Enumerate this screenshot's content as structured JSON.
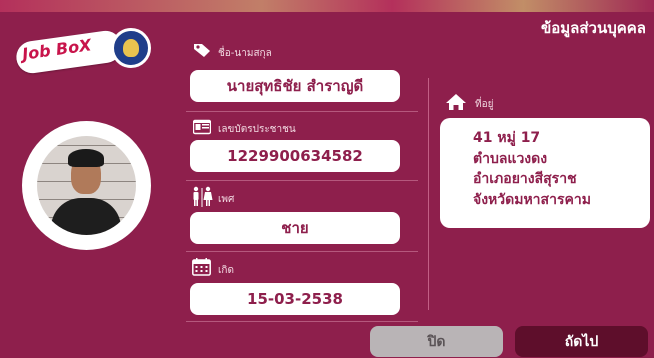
{
  "header": {
    "title": "ข้อมูลส่วนบุคคล"
  },
  "logo": {
    "text": "Job BoX"
  },
  "fields": {
    "name": {
      "label": "ชื่อ-นามสกุล",
      "value": "นายสุทธิชัย สำราญดี"
    },
    "id_card": {
      "label": "เลขบัตรประชาชน",
      "value": "1229900634582"
    },
    "gender": {
      "label": "เพศ",
      "value": "ชาย"
    },
    "birth": {
      "label": "เกิด",
      "value": "15-03-2538"
    }
  },
  "address": {
    "label": "ที่อยู่",
    "lines": [
      "41 หมู่ 17",
      "ตำบลแวงดง",
      "อำเภอยางสีสุราช",
      "จังหวัดมหาสารคาม"
    ]
  },
  "buttons": {
    "close": "ปิด",
    "next": "ถัดไป"
  },
  "icons": {
    "name": "tag-icon",
    "id_card": "id-card-icon",
    "gender": "gender-icon",
    "birth": "calendar-icon",
    "address": "home-icon"
  },
  "colors": {
    "background": "#8e1f4c",
    "accent_text": "#8e1f4c",
    "next_button": "#5e0e2b",
    "close_button": "#b9b4b6"
  }
}
